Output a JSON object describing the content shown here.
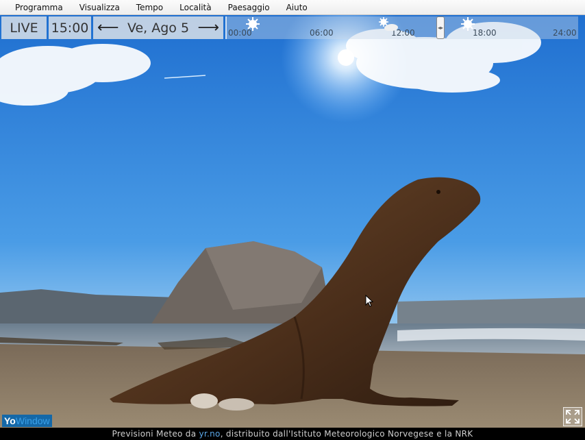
{
  "menu": {
    "items": [
      "Programma",
      "Visualizza",
      "Tempo",
      "Località",
      "Paesaggio",
      "Aiuto"
    ]
  },
  "timebar": {
    "live_label": "LIVE",
    "time": "15:00",
    "date": "Ve, Ago 5",
    "prev_icon": "arrow-left-icon",
    "next_icon": "arrow-right-icon",
    "ticks": [
      "00:00",
      "06:00",
      "12:00",
      "18:00",
      "24:00"
    ],
    "forecast_icons": [
      "sun-icon",
      "partly-cloudy-icon",
      "sun-icon"
    ]
  },
  "footer": {
    "prefix": "Previsioni Meteo da",
    "link": "yr.no",
    "suffix": ", distribuito dall'Istituto Meteorologico Norvegese e la NRK"
  },
  "logo": {
    "part_a": "Yo",
    "part_b": "Window"
  },
  "colors": {
    "sky_top": "#1f6fd0",
    "sky_bottom": "#8fc4ef",
    "sand": "#8a7a66",
    "sea_lion": "#5a3a22"
  }
}
